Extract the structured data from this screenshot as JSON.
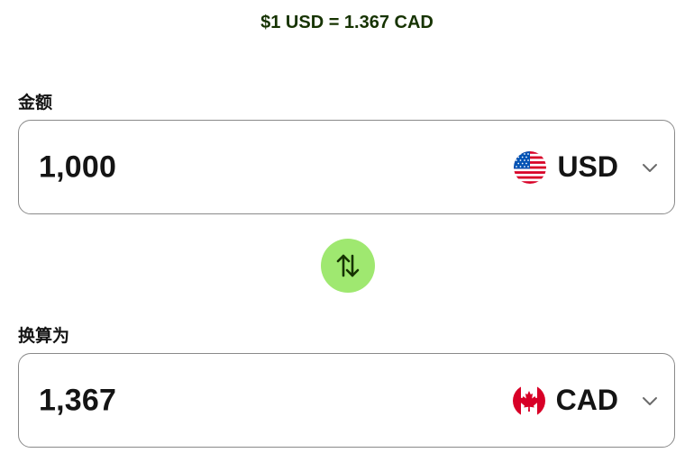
{
  "rate": {
    "text": "$1 USD = 1.367 CAD"
  },
  "amount_field": {
    "label": "金额",
    "value": "1,000",
    "currency_code": "USD",
    "flag_icon": "us-flag-icon"
  },
  "swap": {
    "icon": "swap-arrows-icon",
    "color": "#9fe870"
  },
  "converted_field": {
    "label": "换算为",
    "value": "1,367",
    "currency_code": "CAD",
    "flag_icon": "canada-flag-icon"
  },
  "colors": {
    "accent": "#9fe870",
    "rate_text": "#163300",
    "border": "#8a8a8a"
  }
}
